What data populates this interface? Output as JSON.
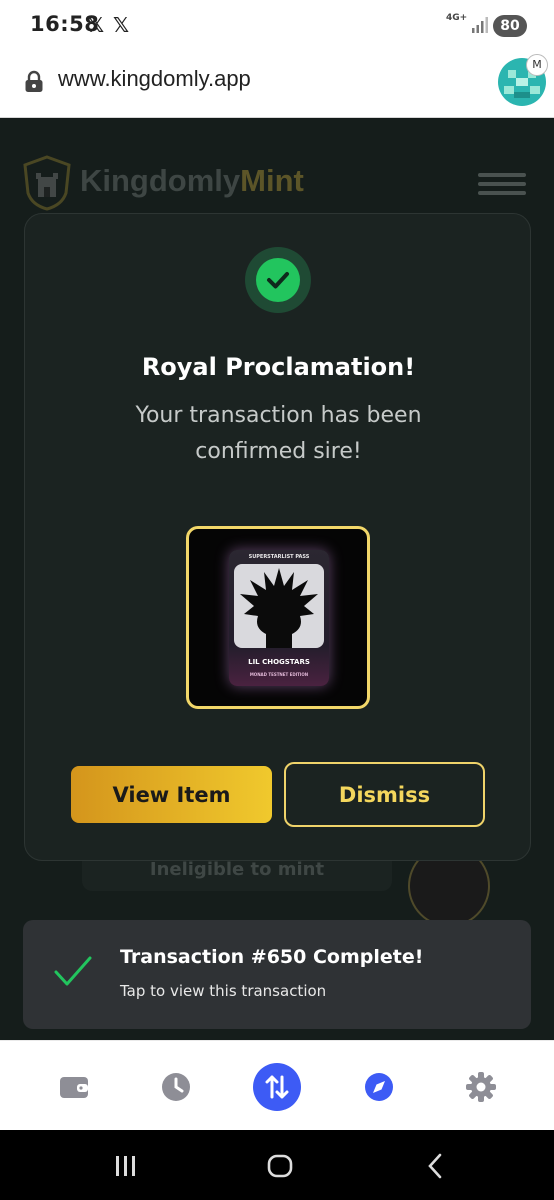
{
  "status_bar": {
    "time": "16:58",
    "app_icons": [
      "𝕏",
      "𝕏"
    ],
    "network": "4G+",
    "battery": "80"
  },
  "browser": {
    "url": "www.kingdomly.app",
    "avatar_badge": "M"
  },
  "page": {
    "logo": {
      "kingdomly": "Kingdomly",
      "mint": "Mint"
    },
    "background_button": "Ineligible to mint"
  },
  "modal": {
    "title": "Royal Proclamation!",
    "message": "Your transaction has been confirmed sire!",
    "nft": {
      "pass_label": "SUPERSTARLIST PASS",
      "name": "LIL CHOGSTARS",
      "edition": "MONAD TESTNET EDITION"
    },
    "view_button": "View Item",
    "dismiss_button": "Dismiss"
  },
  "toast": {
    "title": "Transaction #650 Complete!",
    "subtitle": "Tap to view this transaction"
  },
  "bottom_nav": {
    "items": [
      "wallet-icon",
      "history-icon",
      "swap-icon",
      "explore-icon",
      "settings-icon"
    ],
    "active": "swap-icon",
    "active_color": "#3d5bf5"
  },
  "colors": {
    "accent_gold": "#f0c92d",
    "success_green": "#22c55e",
    "modal_bg": "#1b2321"
  }
}
